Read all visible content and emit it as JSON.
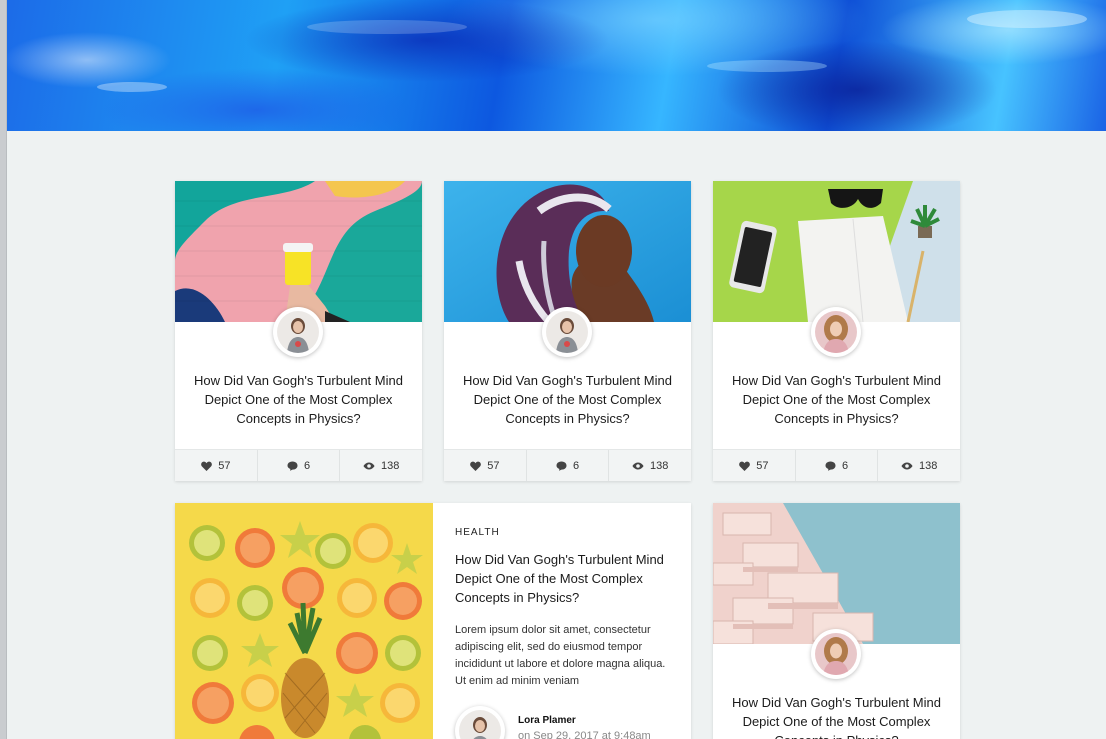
{
  "cards": [
    {
      "title": "How Did Van Gogh's Turbulent Mind Depict One of the Most Complex Concepts in Physics?",
      "likes": "57",
      "comments": "6",
      "views": "138"
    },
    {
      "title": "How Did Van Gogh's Turbulent Mind Depict One of the Most Complex Concepts in Physics?",
      "likes": "57",
      "comments": "6",
      "views": "138"
    },
    {
      "title": "How Did Van Gogh's Turbulent Mind Depict One of the Most Complex Concepts in Physics?",
      "likes": "57",
      "comments": "6",
      "views": "138"
    }
  ],
  "featured": {
    "category": "HEALTH",
    "title": "How Did Van Gogh's Turbulent Mind Depict One of the Most Complex Concepts in Physics?",
    "excerpt": "Lorem ipsum dolor sit amet, consectetur adipiscing elit, sed do eiusmod tempor incididunt ut labore et dolore magna aliqua. Ut enim ad minim veniam",
    "author": "Lora Plamer",
    "date": "on Sep 29, 2017 at 9:48am"
  },
  "bottom_card": {
    "title": "How Did Van Gogh's Turbulent Mind Depict One of the Most Complex Concepts in Physics?"
  },
  "icons": {
    "like": "heart-icon",
    "comment": "comment-icon",
    "view": "eye-icon"
  },
  "colors": {
    "page_bg": "#eef2f2",
    "stats_bg": "#f2f4f4",
    "hero_blue": "#1a72ea"
  }
}
